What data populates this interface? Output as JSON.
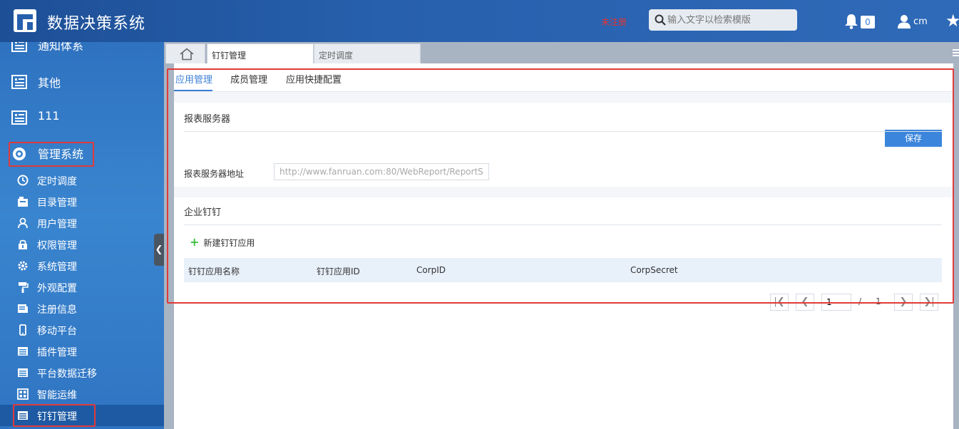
{
  "header": {
    "app_title": "数据决策系统",
    "unregistered": "未注册",
    "search_placeholder": "输入文字以检索模版",
    "notification_count": "0",
    "user_name": "cm"
  },
  "sidebar": {
    "top_items": [
      {
        "label": "通知体系",
        "icon": "document-icon"
      },
      {
        "label": "其他",
        "icon": "document-icon"
      },
      {
        "label": "111",
        "icon": "document-icon"
      },
      {
        "label": "管理系统",
        "icon": "gear-flower-icon"
      }
    ],
    "sub_items": [
      {
        "label": "定时调度",
        "icon": "clock-icon"
      },
      {
        "label": "目录管理",
        "icon": "folder-icon"
      },
      {
        "label": "用户管理",
        "icon": "user-icon"
      },
      {
        "label": "权限管理",
        "icon": "lock-icon"
      },
      {
        "label": "系统管理",
        "icon": "gear-icon"
      },
      {
        "label": "外观配置",
        "icon": "paint-roller-icon"
      },
      {
        "label": "注册信息",
        "icon": "register-icon"
      },
      {
        "label": "移动平台",
        "icon": "mobile-icon"
      },
      {
        "label": "插件管理",
        "icon": "plugin-icon"
      },
      {
        "label": "平台数据迁移",
        "icon": "migrate-icon"
      },
      {
        "label": "智能运维",
        "icon": "grid-icon"
      },
      {
        "label": "钉钉管理",
        "icon": "dingtalk-icon"
      }
    ]
  },
  "tabs": {
    "items": [
      "钉钉管理",
      "定时调度"
    ]
  },
  "subtabs": [
    "应用管理",
    "成员管理",
    "应用快捷配置"
  ],
  "report_server": {
    "title": "报表服务器",
    "save_label": "保存",
    "field_label": "报表服务器地址",
    "field_placeholder": "http://www.fanruan.com:80/WebReport/ReportS..."
  },
  "dingtalk": {
    "title": "企业钉钉",
    "add_label": "新建钉钉应用",
    "columns": [
      "钉钉应用名称",
      "钉钉应用ID",
      "CorpID",
      "CorpSecret"
    ]
  },
  "pagination": {
    "current_page": "1",
    "separator": "/",
    "total_pages": "1"
  },
  "colors": {
    "header_bg": "#2760ad",
    "sidebar_bg": "#3a85cf",
    "accent": "#3b86dc",
    "highlight_box": "#e03a3a"
  }
}
